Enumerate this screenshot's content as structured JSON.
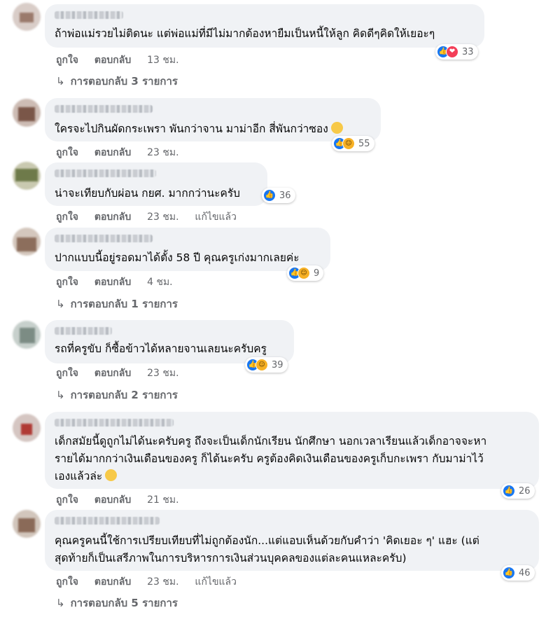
{
  "comments": [
    {
      "text_lines": [
        "ถ้าพ่อแม่รวยไม่ติดนะ แต่พ่อแม่ที่มีไม่มากต้องหายืมเป็นหนี้ให้ลูก คิดดีๆคิดให้เยอะๆ"
      ],
      "reaction_icons": [
        "like-icon",
        "love-icon"
      ],
      "reaction_count": "33",
      "like_label": "ถูกใจ",
      "reply_label": "ตอบกลับ",
      "time": "13 ชม.",
      "edited_label": "",
      "replies_label": "การตอบกลับ 3 รายการ"
    },
    {
      "text_lines": [
        "ใครจะไปกินผัดกระเพรา พันกว่าจาน มาม่าอีก สี่พันกว่าซอง"
      ],
      "reaction_icons": [
        "like-icon",
        "haha-icon"
      ],
      "reaction_count": "55",
      "like_label": "ถูกใจ",
      "reply_label": "ตอบกลับ",
      "time": "23 ชม.",
      "edited_label": "",
      "replies_label": ""
    },
    {
      "text_lines": [
        "น่าจะเทียบกับผ่อน กยศ. มากกว่านะครับ"
      ],
      "reaction_icons": [
        "like-icon"
      ],
      "reaction_count": "36",
      "like_label": "ถูกใจ",
      "reply_label": "ตอบกลับ",
      "time": "23 ชม.",
      "edited_label": "แก้ไขแล้ว",
      "replies_label": ""
    },
    {
      "text_lines": [
        "ปากแบบนี้อยู่รอดมาได้ตั้ง 58 ปี คุณครูเก่งมากเลยค่ะ"
      ],
      "reaction_icons": [
        "like-icon",
        "haha-icon"
      ],
      "reaction_count": "9",
      "like_label": "ถูกใจ",
      "reply_label": "ตอบกลับ",
      "time": "4 ชม.",
      "edited_label": "",
      "replies_label": "การตอบกลับ 1 รายการ"
    },
    {
      "text_lines": [
        "รถที่ครูขับ ก็ซื้อข้าวได้หลายจานเลยนะครับครู"
      ],
      "reaction_icons": [
        "like-icon",
        "haha-icon"
      ],
      "reaction_count": "39",
      "like_label": "ถูกใจ",
      "reply_label": "ตอบกลับ",
      "time": "23 ชม.",
      "edited_label": "",
      "replies_label": "การตอบกลับ 2 รายการ"
    },
    {
      "text_lines": [
        "เด็กสมัยนี้ดูถูกไม่ได้นะครับครู ถึงจะเป็นเด็กนักเรียน นักศึกษา นอกเวลาเรียนแล้วเด็กอาจจะหา",
        "รายได้มากกว่าเงินเดือนของครู ก็ได้นะครับ ครูต้องคิดเงินเดือนของครูเก็บกะเพรา กับมาม่าไว้",
        "เองแล้วล่ะ"
      ],
      "reaction_icons": [
        "like-icon"
      ],
      "reaction_count": "26",
      "like_label": "ถูกใจ",
      "reply_label": "ตอบกลับ",
      "time": "21 ชม.",
      "edited_label": "",
      "replies_label": ""
    },
    {
      "text_lines": [
        "คุณครูคนนี้ใช้การเปรียบเทียบที่ไม่ถูกต้องนัก...แต่แอบเห็นด้วยกับคำว่า 'คิดเยอะ ๆ' แฮะ (แต่",
        "สุดท้ายก็เป็นเสรีภาพในการบริหารการเงินส่วนบุคคลของแต่ละคนแหละครับ)"
      ],
      "reaction_icons": [
        "like-icon"
      ],
      "reaction_count": "46",
      "like_label": "ถูกใจ",
      "reply_label": "ตอบกลับ",
      "time": "23 ชม.",
      "edited_label": "แก้ไขแล้ว",
      "replies_label": "การตอบกลับ 5 รายการ"
    }
  ],
  "icons": {
    "reply_arrow": "reply-arrow-icon"
  },
  "colors": {
    "bubble": "#f0f2f5",
    "like": "#1877f2",
    "love": "#f33e58",
    "haha": "#f7b125",
    "meta_text": "#65676b"
  }
}
